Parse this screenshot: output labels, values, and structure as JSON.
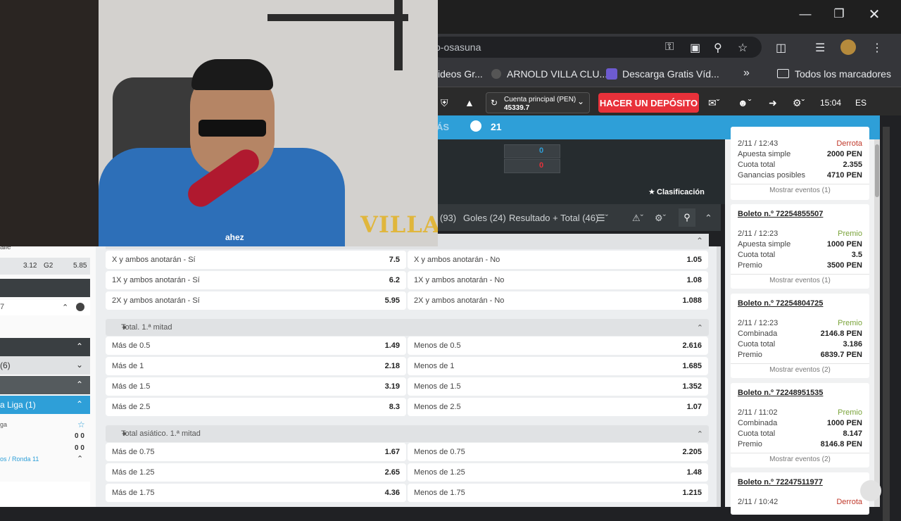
{
  "browser": {
    "url_fragment": "o-osasuna",
    "bookmarks": [
      "ideos Gr...",
      "ARNOLD VILLA CLU...",
      "Descarga Gratis Víd...",
      "Todos los marcadores"
    ],
    "window_buttons": [
      "minimize",
      "restore",
      "close"
    ]
  },
  "header": {
    "account_name": "Cuenta principal  (PEN)",
    "account_balance": "45339.7",
    "deposit_label": "HACER UN DEPÓSITO",
    "time": "15:04",
    "lang": "ES"
  },
  "bluebar": {
    "more_label": "ÁS",
    "count": "21"
  },
  "hero": {
    "score_top": "0",
    "score_bottom": "0",
    "clasificacion": "Clasificación"
  },
  "market_tabs": [
    "(93)",
    "Goles (24)",
    "Resultado + Total (46)"
  ],
  "both_teams": [
    {
      "l_label": "X y ambos anotarán - Sí",
      "l_odd": "7.5",
      "r_label": "X y ambos anotarán - No",
      "r_odd": "1.05"
    },
    {
      "l_label": "1X y ambos anotarán - Sí",
      "l_odd": "6.2",
      "r_label": "1X y ambos anotarán - No",
      "r_odd": "1.08"
    },
    {
      "l_label": "2X y ambos anotarán - Sí",
      "l_odd": "5.95",
      "r_label": "2X y ambos anotarán - No",
      "r_odd": "1.088"
    }
  ],
  "total_half": {
    "title": "Total. 1.ª mitad",
    "rows": [
      {
        "l_label": "Más de 0.5",
        "l_odd": "1.49",
        "r_label": "Menos de 0.5",
        "r_odd": "2.616"
      },
      {
        "l_label": "Más de 1",
        "l_odd": "2.18",
        "r_label": "Menos de 1",
        "r_odd": "1.685"
      },
      {
        "l_label": "Más de 1.5",
        "l_odd": "3.19",
        "r_label": "Menos de 1.5",
        "r_odd": "1.352"
      },
      {
        "l_label": "Más de 2.5",
        "l_odd": "8.3",
        "r_label": "Menos de 2.5",
        "r_odd": "1.07"
      }
    ]
  },
  "asian_half": {
    "title": "Total asiático. 1.ª mitad",
    "rows": [
      {
        "l_label": "Más de 0.75",
        "l_odd": "1.67",
        "r_label": "Menos de 0.75",
        "r_odd": "2.205"
      },
      {
        "l_label": "Más de 1.25",
        "l_odd": "2.65",
        "r_label": "Menos de 1.25",
        "r_odd": "1.48"
      },
      {
        "l_label": "Más de 1.75",
        "l_odd": "4.36",
        "r_label": "Menos de 1.75",
        "r_odd": "1.215"
      }
    ]
  },
  "left_sidebar": {
    "top_text": "alle",
    "odd1": "3.12",
    "odd_label": "G2",
    "odd2": "5.85",
    "row_7": "7",
    "row_6": "(6)",
    "liga": "a Liga (1)",
    "liga_name": "ga",
    "score_a": "0 0",
    "score_b": "0 0",
    "ronda": "os / Ronda 11"
  },
  "tickets": [
    {
      "date": "2/11 / 12:43",
      "status": "Derrota",
      "l1": "Apuesta simple",
      "v1": "2000 PEN",
      "l2": "Cuota total",
      "v2": "2.355",
      "l3": "Ganancias posibles",
      "v3": "4710 PEN",
      "more": "Mostrar eventos (1)"
    },
    {
      "title": "Boleto n.º 72254855507",
      "date": "2/11 / 12:23",
      "status": "Premio",
      "l1": "Apuesta simple",
      "v1": "1000 PEN",
      "l2": "Cuota total",
      "v2": "3.5",
      "l3": "Premio",
      "v3": "3500 PEN",
      "more": "Mostrar eventos (1)"
    },
    {
      "title": "Boleto n.º 72254804725",
      "date": "2/11 / 12:23",
      "status": "Premio",
      "l1": "Combinada",
      "v1": "2146.8 PEN",
      "l2": "Cuota total",
      "v2": "3.186",
      "l3": "Premio",
      "v3": "6839.7 PEN",
      "more": "Mostrar eventos (2)"
    },
    {
      "title": "Boleto n.º 72248951535",
      "date": "2/11 / 11:02",
      "status": "Premio",
      "l1": "Combinada",
      "v1": "1000 PEN",
      "l2": "Cuota total",
      "v2": "8.147",
      "l3": "Premio",
      "v3": "8146.8 PEN",
      "more": "Mostrar eventos (2)"
    },
    {
      "title": "Boleto n.º 72247511977",
      "date": "2/11 / 10:42",
      "status": "Derrota"
    }
  ],
  "webcam": {
    "overlay_text": "VILLA",
    "shirt_text": "ahez"
  },
  "colors": {
    "accent_blue": "#2e9fd8",
    "deposit_red": "#e8313a",
    "win_green": "#7aa33a",
    "loss_red": "#c0392b"
  }
}
